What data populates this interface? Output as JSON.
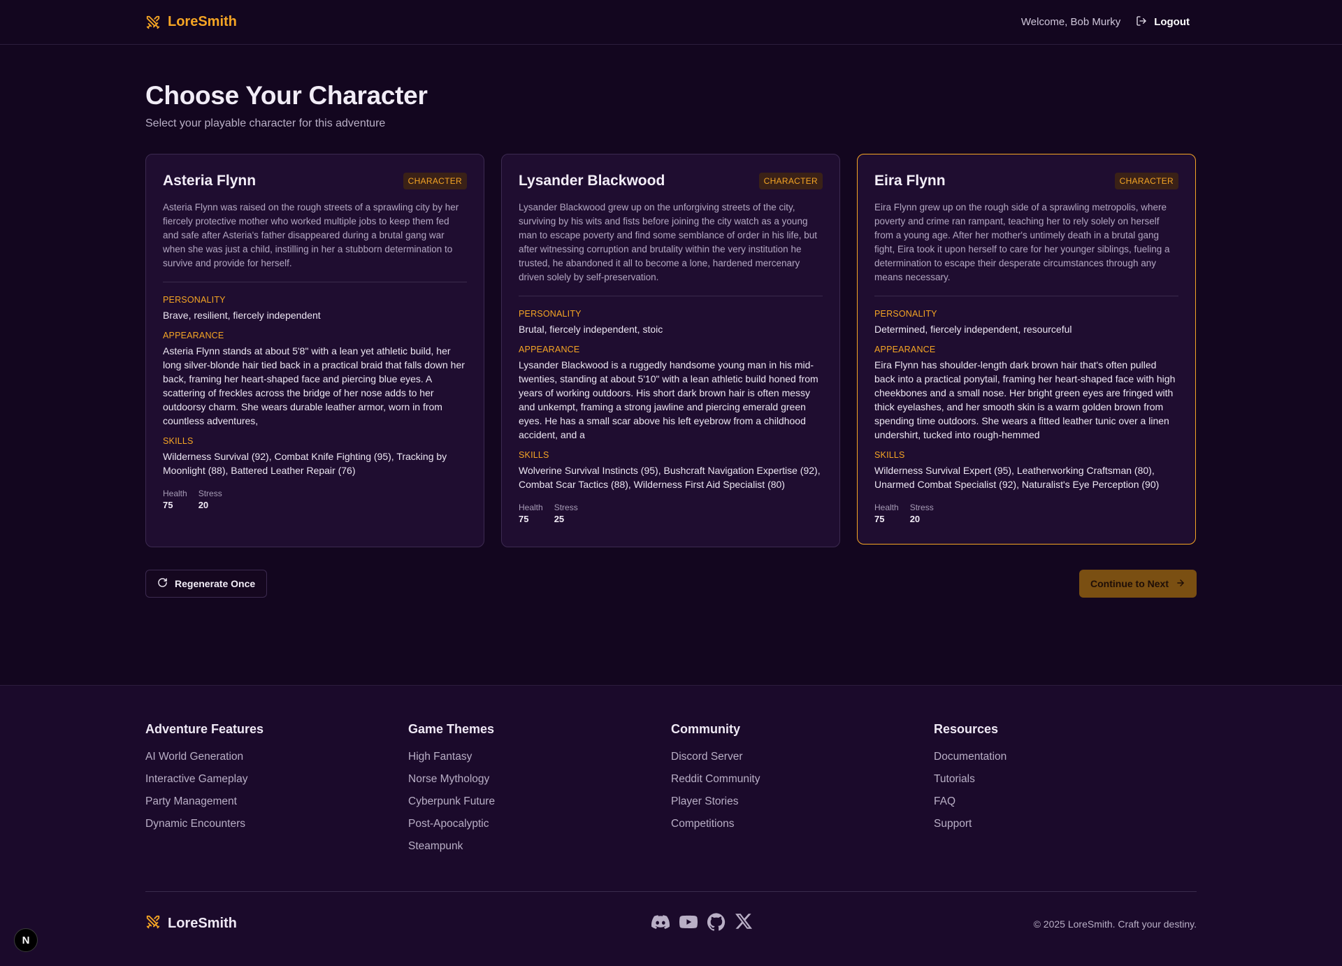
{
  "header": {
    "brand": "LoreSmith",
    "welcome": "Welcome, Bob Murky",
    "logout": "Logout"
  },
  "page": {
    "title": "Choose Your Character",
    "subtitle": "Select your playable character for this adventure"
  },
  "labels": {
    "badge": "CHARACTER",
    "personality": "PERSONALITY",
    "appearance": "APPEARANCE",
    "skills": "SKILLS",
    "health": "Health",
    "stress": "Stress"
  },
  "characters": [
    {
      "name": "Asteria Flynn",
      "description": "Asteria Flynn was raised on the rough streets of a sprawling city by her fiercely protective mother who worked multiple jobs to keep them fed and safe after Asteria's father disappeared during a brutal gang war when she was just a child, instilling in her a stubborn determination to survive and provide for herself.",
      "personality": "Brave, resilient, fiercely independent",
      "appearance": "Asteria Flynn stands at about 5'8\" with a lean yet athletic build, her long silver-blonde hair tied back in a practical braid that falls down her back, framing her heart-shaped face and piercing blue eyes. A scattering of freckles across the bridge of her nose adds to her outdoorsy charm. She wears durable leather armor, worn in from countless adventures,",
      "skills": "Wilderness Survival (92), Combat Knife Fighting (95), Tracking by Moonlight (88), Battered Leather Repair (76)",
      "health": "75",
      "stress": "20"
    },
    {
      "name": "Lysander Blackwood",
      "description": "Lysander Blackwood grew up on the unforgiving streets of the city, surviving by his wits and fists before joining the city watch as a young man to escape poverty and find some semblance of order in his life, but after witnessing corruption and brutality within the very institution he trusted, he abandoned it all to become a lone, hardened mercenary driven solely by self-preservation.",
      "personality": "Brutal, fiercely independent, stoic",
      "appearance": "Lysander Blackwood is a ruggedly handsome young man in his mid-twenties, standing at about 5'10\" with a lean athletic build honed from years of working outdoors. His short dark brown hair is often messy and unkempt, framing a strong jawline and piercing emerald green eyes. He has a small scar above his left eyebrow from a childhood accident, and a",
      "skills": "Wolverine Survival Instincts (95), Bushcraft Navigation Expertise (92), Combat Scar Tactics (88), Wilderness First Aid Specialist (80)",
      "health": "75",
      "stress": "25"
    },
    {
      "name": "Eira Flynn",
      "description": "Eira Flynn grew up on the rough side of a sprawling metropolis, where poverty and crime ran rampant, teaching her to rely solely on herself from a young age. After her mother's untimely death in a brutal gang fight, Eira took it upon herself to care for her younger siblings, fueling a determination to escape their desperate circumstances through any means necessary.",
      "personality": "Determined, fiercely independent, resourceful",
      "appearance": "Eira Flynn has shoulder-length dark brown hair that's often pulled back into a practical ponytail, framing her heart-shaped face with high cheekbones and a small nose. Her bright green eyes are fringed with thick eyelashes, and her smooth skin is a warm golden brown from spending time outdoors. She wears a fitted leather tunic over a linen undershirt, tucked into rough-hemmed",
      "skills": "Wilderness Survival Expert (95), Leatherworking Craftsman (80), Unarmed Combat Specialist (92), Naturalist's Eye Perception (90)",
      "health": "75",
      "stress": "20"
    }
  ],
  "actions": {
    "regenerate": "Regenerate Once",
    "continue": "Continue to Next"
  },
  "footer": {
    "columns": [
      {
        "title": "Adventure Features",
        "links": [
          "AI World Generation",
          "Interactive Gameplay",
          "Party Management",
          "Dynamic Encounters"
        ]
      },
      {
        "title": "Game Themes",
        "links": [
          "High Fantasy",
          "Norse Mythology",
          "Cyberpunk Future",
          "Post-Apocalyptic",
          "Steampunk"
        ]
      },
      {
        "title": "Community",
        "links": [
          "Discord Server",
          "Reddit Community",
          "Player Stories",
          "Competitions"
        ]
      },
      {
        "title": "Resources",
        "links": [
          "Documentation",
          "Tutorials",
          "FAQ",
          "Support"
        ]
      }
    ],
    "brand": "LoreSmith",
    "copyright": "© 2025 LoreSmith. Craft your destiny.",
    "socials": [
      "discord-icon",
      "youtube-icon",
      "github-icon",
      "x-icon"
    ]
  },
  "corner_badge": "N",
  "colors": {
    "accent": "#f5a524",
    "background": "#13061f",
    "card": "#1f0d30",
    "footer": "#1b0a2b"
  }
}
